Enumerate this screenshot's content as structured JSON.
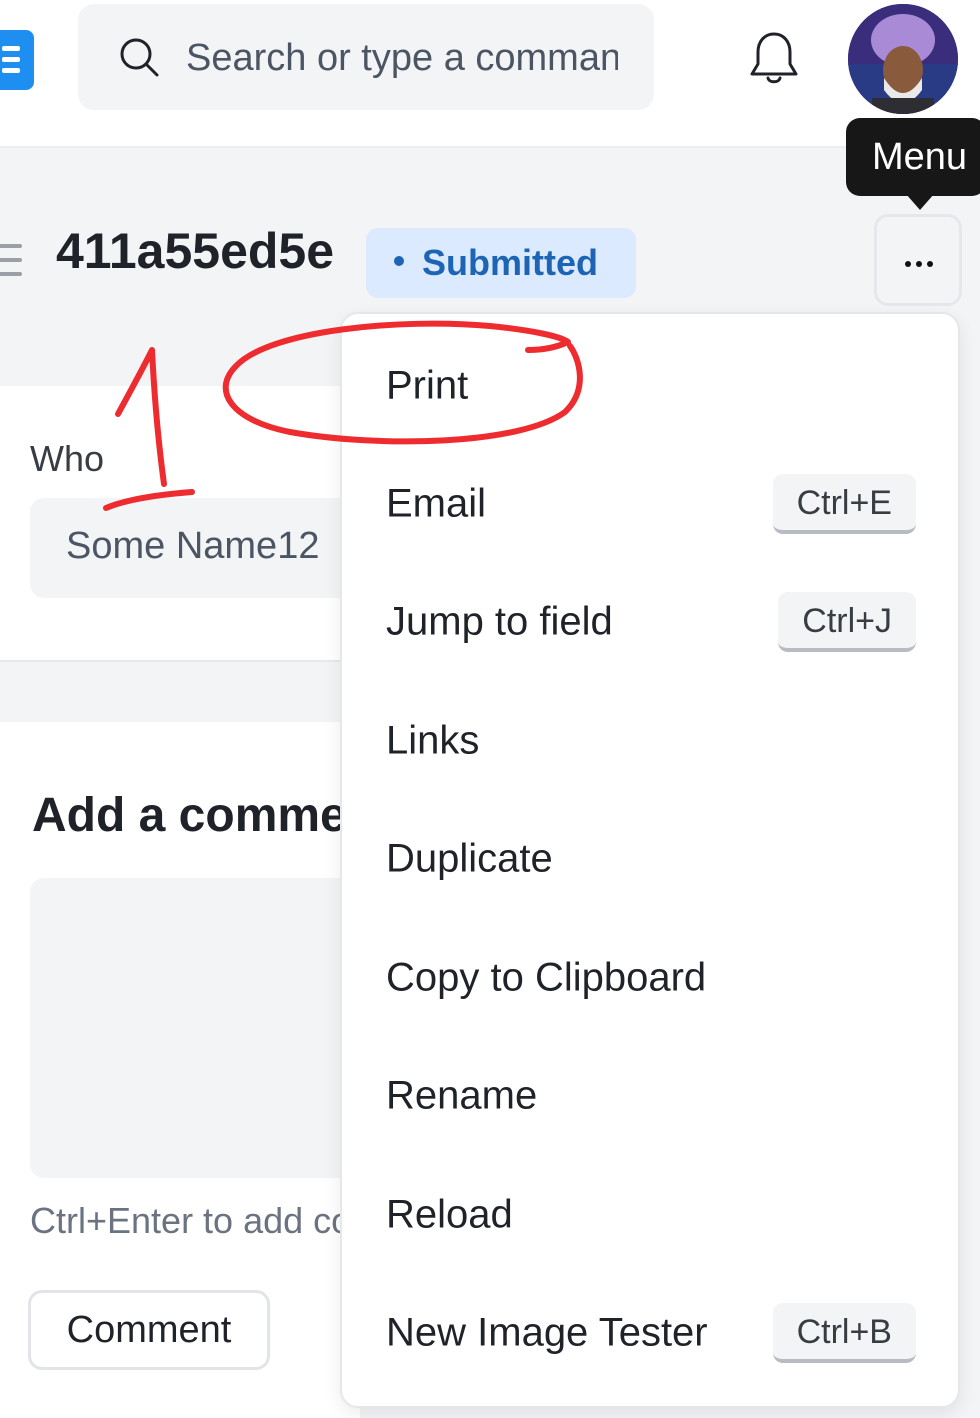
{
  "navbar": {
    "search_placeholder": "Search or type a command",
    "icons": [
      "app-logo-icon",
      "search-icon",
      "bell-icon",
      "avatar"
    ]
  },
  "tooltip": {
    "text": "Menu"
  },
  "page_head": {
    "title": "411a55ed5e",
    "status": "Submitted",
    "status_colors": {
      "background": "#dbeafe",
      "text": "#1d64b4"
    }
  },
  "form": {
    "who_label": "Who",
    "who_value": "Some Name12"
  },
  "comment": {
    "title": "Add a comment",
    "hint": "Ctrl+Enter to add comment",
    "button_label": "Comment"
  },
  "menu": {
    "items": [
      {
        "label": "Print",
        "shortcut": ""
      },
      {
        "label": "Email",
        "shortcut": "Ctrl+E"
      },
      {
        "label": "Jump to field",
        "shortcut": "Ctrl+J"
      },
      {
        "label": "Links",
        "shortcut": ""
      },
      {
        "label": "Duplicate",
        "shortcut": ""
      },
      {
        "label": "Copy to Clipboard",
        "shortcut": ""
      },
      {
        "label": "Rename",
        "shortcut": ""
      },
      {
        "label": "Reload",
        "shortcut": ""
      },
      {
        "label": "New Image Tester",
        "shortcut": "Ctrl+B"
      }
    ]
  },
  "annotation": {
    "marker": "1",
    "color": "#ee2b2f"
  }
}
